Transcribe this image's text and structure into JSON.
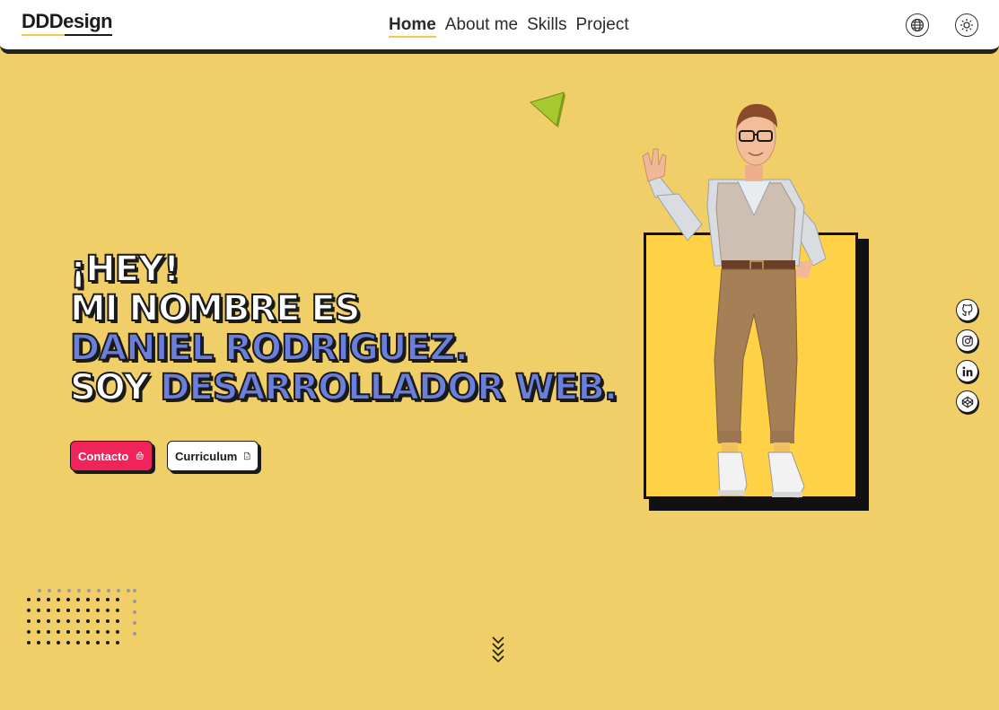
{
  "header": {
    "logo": "DDDesign",
    "nav": [
      {
        "label": "Home",
        "active": true
      },
      {
        "label": "About me",
        "active": false
      },
      {
        "label": "Skills",
        "active": false
      },
      {
        "label": "Project",
        "active": false
      }
    ],
    "icons": [
      "globe-icon",
      "sun-icon"
    ]
  },
  "hero": {
    "line1": "¡HEY!",
    "line2": "MI NOMBRE ES",
    "line3": "DANIEL RODRIGUEZ.",
    "line4_prefix": "SOY ",
    "line4_accent": "DESARROLLADOR WEB."
  },
  "buttons": {
    "contact_label": "Contacto",
    "cv_label": "Curriculum",
    "cv_icon_text": "cv"
  },
  "social": [
    "github-icon",
    "instagram-icon",
    "linkedin-icon",
    "codepen-icon"
  ],
  "colors": {
    "background": "#f0cf68",
    "accent_blue": "#6a7fdc",
    "contact_pink": "#f0245a",
    "card_yellow": "#ffd147"
  }
}
